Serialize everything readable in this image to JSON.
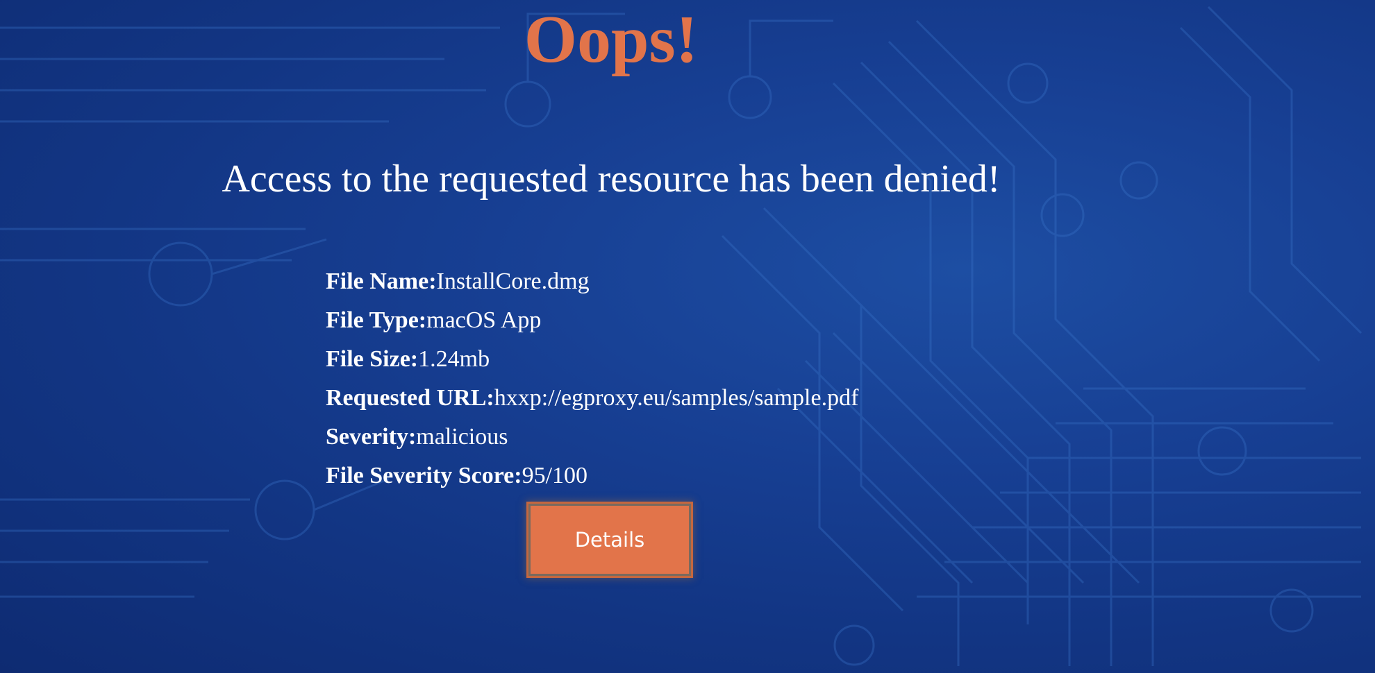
{
  "title": "Oops!",
  "subtitle": "Access to the requested resource has been denied!",
  "file_info": [
    {
      "label": "File Name:",
      "value": "InstallCore.dmg"
    },
    {
      "label": "File Type:",
      "value": "macOS App"
    },
    {
      "label": "File Size:",
      "value": "1.24mb"
    },
    {
      "label": "Requested URL:",
      "value": "hxxp://egproxy.eu/samples/sample.pdf"
    },
    {
      "label": "Severity:",
      "value": "malicious"
    },
    {
      "label": "File Severity Score:",
      "value": "95/100"
    }
  ],
  "details_button": {
    "label": "Details"
  },
  "colors": {
    "accent": "#e2744a",
    "background": "#173f93",
    "text": "#ffffff"
  },
  "icons": {
    "background": "circuit-board-pattern"
  }
}
